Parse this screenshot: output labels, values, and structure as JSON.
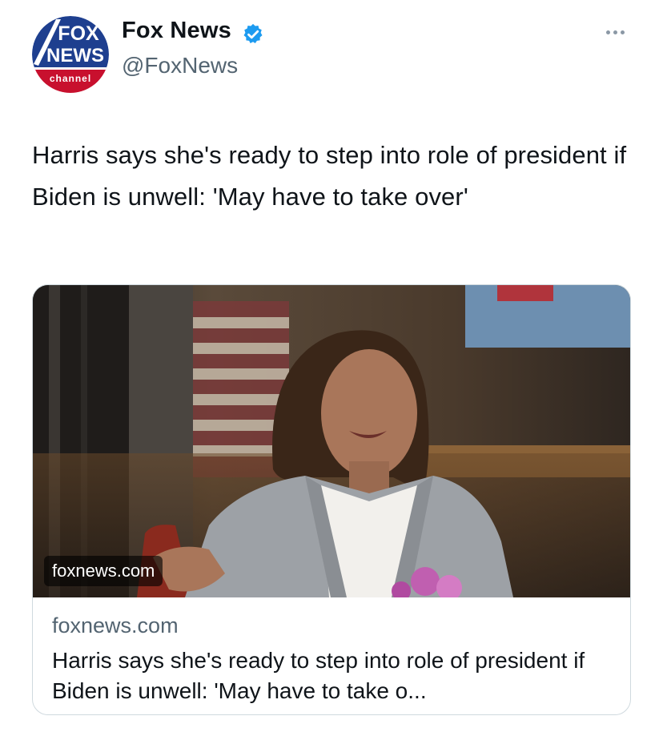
{
  "author": {
    "name": "Fox News",
    "handle": "@FoxNews",
    "verified": true,
    "avatar_logo": {
      "line1": "FOX",
      "line2": "NEWS",
      "line3": "channel"
    }
  },
  "menu": {
    "icon": "more-dots-icon"
  },
  "tweet": {
    "text": "Harris says she's ready to step into role of president if Biden is unwell: 'May have to take over'"
  },
  "card": {
    "image_overlay_domain": "foxnews.com",
    "domain": "foxnews.com",
    "title": "Harris says she's ready to step into role of president if Biden is unwell: 'May have to take o..."
  },
  "colors": {
    "verified_blue": "#1d9bf0",
    "text": "#0f1419",
    "secondary": "#536471",
    "border": "#cfd9de",
    "fox_blue": "#1e3f8f",
    "fox_red": "#c8102e"
  }
}
